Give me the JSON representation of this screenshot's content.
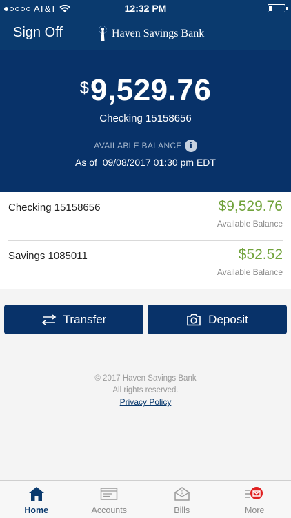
{
  "status_bar": {
    "carrier": "AT&T",
    "time": "12:32 PM"
  },
  "header": {
    "sign_off_label": "Sign Off",
    "brand_name": "Haven Savings Bank"
  },
  "hero": {
    "currency_symbol": "$",
    "amount": "9,529.76",
    "account": "Checking 15158656",
    "available_label": "AVAILABLE BALANCE",
    "as_of_label": "As of",
    "as_of_value": "09/08/2017 01:30 pm EDT"
  },
  "accounts": [
    {
      "name": "Checking 15158656",
      "balance": "$9,529.76",
      "balance_label": "Available Balance"
    },
    {
      "name": "Savings 1085011",
      "balance": "$52.52",
      "balance_label": "Available Balance"
    }
  ],
  "actions": {
    "transfer_label": "Transfer",
    "deposit_label": "Deposit"
  },
  "footer": {
    "copyright": "© 2017 Haven Savings Bank",
    "rights": "All rights reserved.",
    "privacy_link": "Privacy Policy"
  },
  "tabs": [
    {
      "label": "Home",
      "icon": "home-icon",
      "active": true
    },
    {
      "label": "Accounts",
      "icon": "accounts-icon",
      "active": false
    },
    {
      "label": "Bills",
      "icon": "bills-icon",
      "active": false
    },
    {
      "label": "More",
      "icon": "more-icon",
      "active": false
    }
  ],
  "colors": {
    "primary": "#083269",
    "header": "#0a3a6e",
    "balance_green": "#71a33c",
    "notification_red": "#e02020"
  }
}
